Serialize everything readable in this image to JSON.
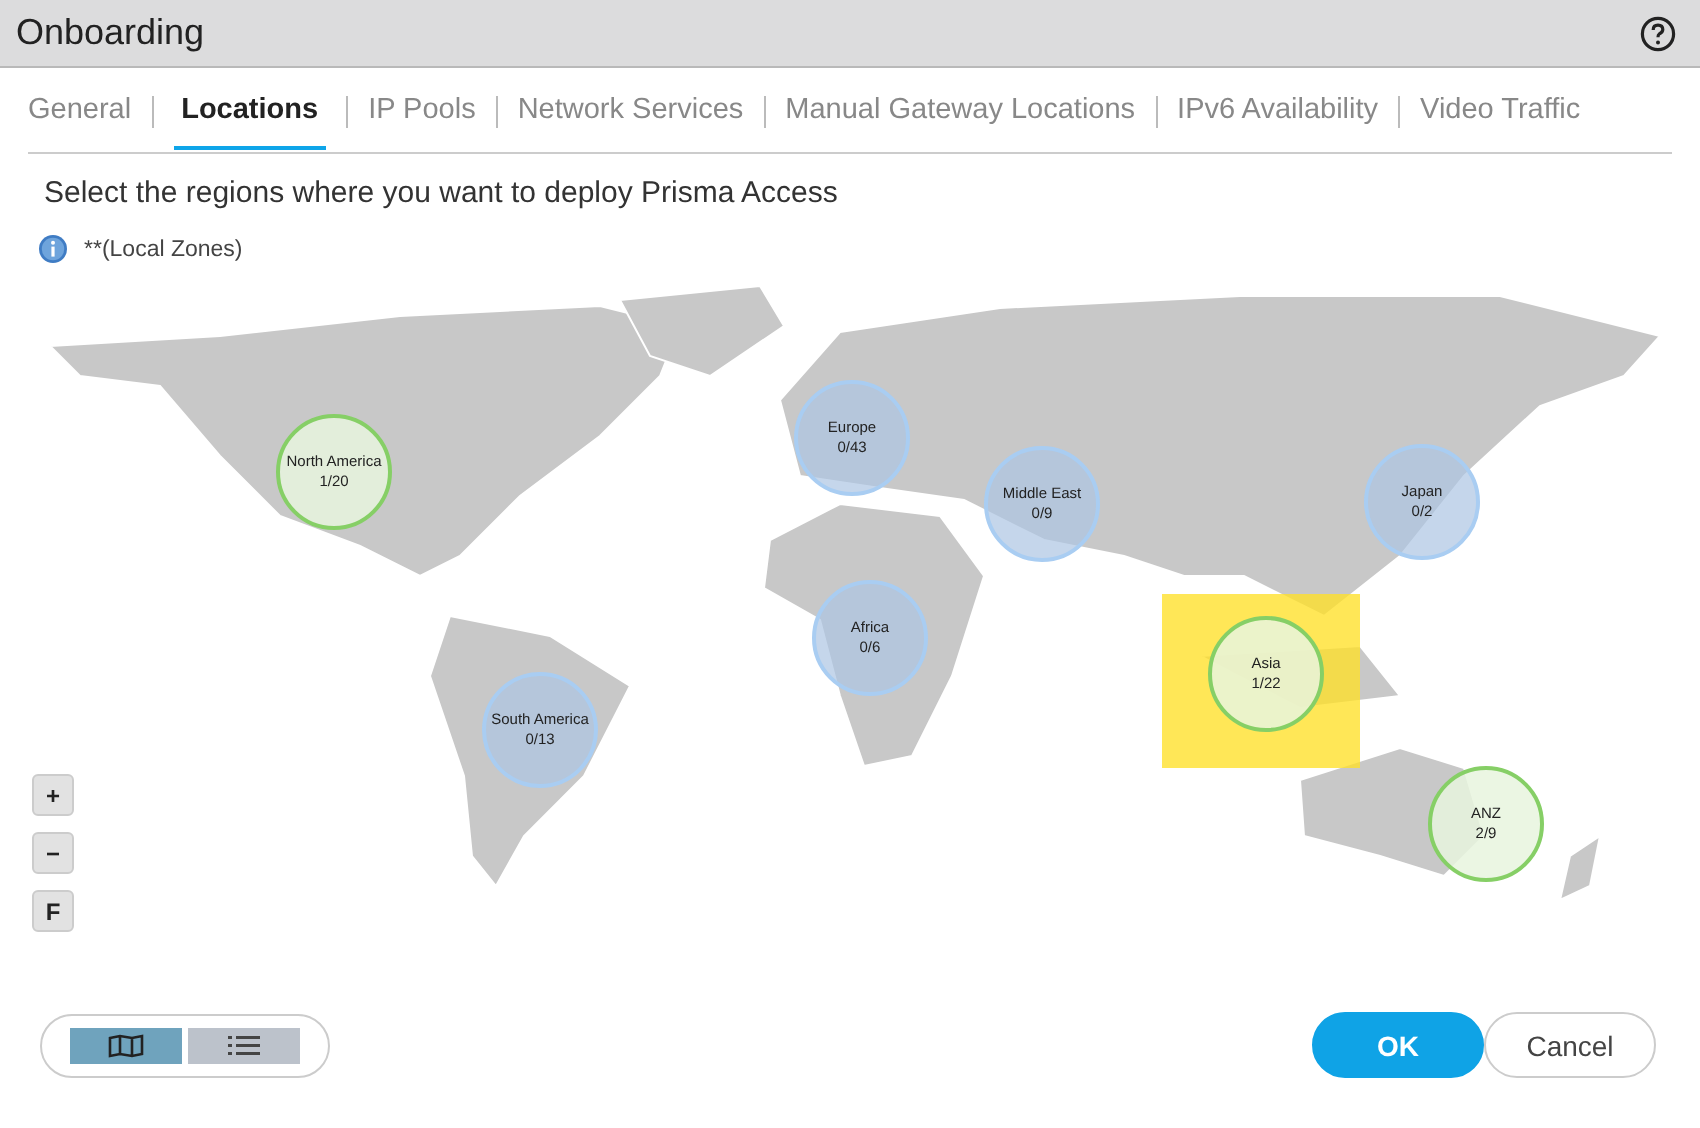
{
  "window": {
    "title": "Onboarding"
  },
  "tabs": [
    {
      "label": "General",
      "selected": false
    },
    {
      "label": "Locations",
      "selected": true
    },
    {
      "label": "IP Pools",
      "selected": false
    },
    {
      "label": "Network Services",
      "selected": false
    },
    {
      "label": "Manual Gateway Locations",
      "selected": false
    },
    {
      "label": "IPv6 Availability",
      "selected": false
    },
    {
      "label": "Video Traffic",
      "selected": false
    }
  ],
  "instruction": "Select the regions where you want to deploy Prisma Access",
  "info_note": "**(Local Zones)",
  "regions": [
    {
      "name": "North America",
      "count": "1/20",
      "selected": true,
      "highlighted": false
    },
    {
      "name": "Europe",
      "count": "0/43",
      "selected": false,
      "highlighted": false
    },
    {
      "name": "Middle East",
      "count": "0/9",
      "selected": false,
      "highlighted": false
    },
    {
      "name": "Japan",
      "count": "0/2",
      "selected": false,
      "highlighted": false
    },
    {
      "name": "Africa",
      "count": "0/6",
      "selected": false,
      "highlighted": false
    },
    {
      "name": "Asia",
      "count": "1/22",
      "selected": true,
      "highlighted": true
    },
    {
      "name": "South America",
      "count": "0/13",
      "selected": false,
      "highlighted": false
    },
    {
      "name": "ANZ",
      "count": "2/9",
      "selected": true,
      "highlighted": false
    }
  ],
  "zoom_controls": [
    "+",
    "−",
    "F"
  ],
  "view_toggle": [
    {
      "kind": "map",
      "selected": true
    },
    {
      "kind": "list",
      "selected": false
    }
  ],
  "buttons": [
    {
      "label": "OK",
      "kind": "primary"
    },
    {
      "label": "Cancel",
      "kind": "secondary"
    }
  ]
}
